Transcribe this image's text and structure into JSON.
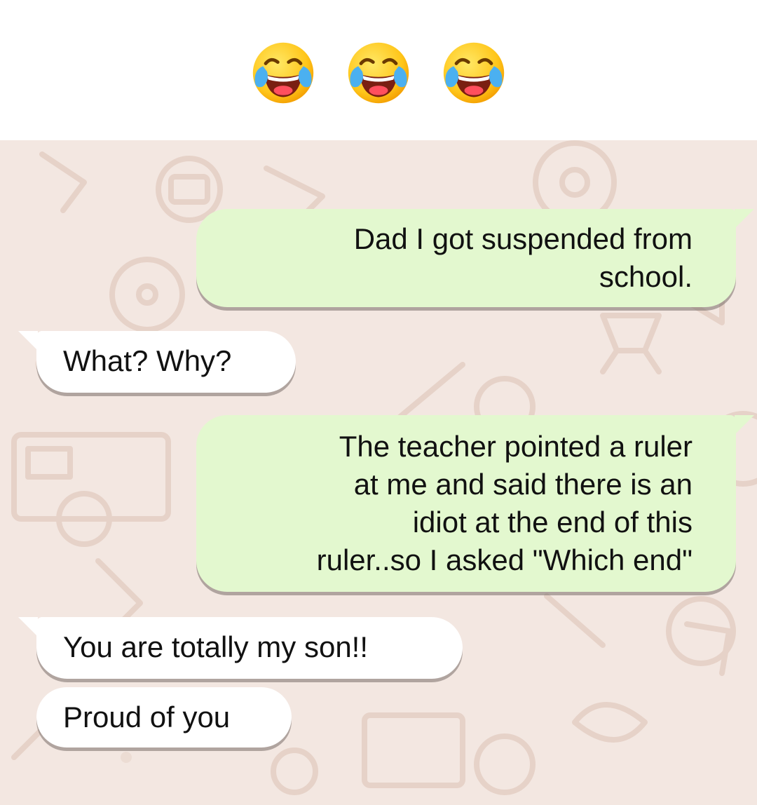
{
  "header": {
    "emojis": [
      "face-with-tears-of-joy-icon",
      "face-with-tears-of-joy-icon",
      "face-with-tears-of-joy-icon"
    ]
  },
  "chat": {
    "messages": [
      {
        "direction": "outgoing",
        "text": "Dad I got suspended from\nschool."
      },
      {
        "direction": "incoming",
        "text": "What? Why?"
      },
      {
        "direction": "outgoing",
        "text": "The teacher pointed a ruler\nat me and said there is an\nidiot at the end of this\nruler..so I asked \"Which end\""
      },
      {
        "direction": "incoming",
        "text": "You are totally my son!!"
      },
      {
        "direction": "incoming",
        "text": "Proud of you"
      }
    ]
  },
  "colors": {
    "outgoing_bubble": "#e3f8cf",
    "incoming_bubble": "#ffffff",
    "wallpaper": "#f3e7e1",
    "text": "#111111"
  }
}
